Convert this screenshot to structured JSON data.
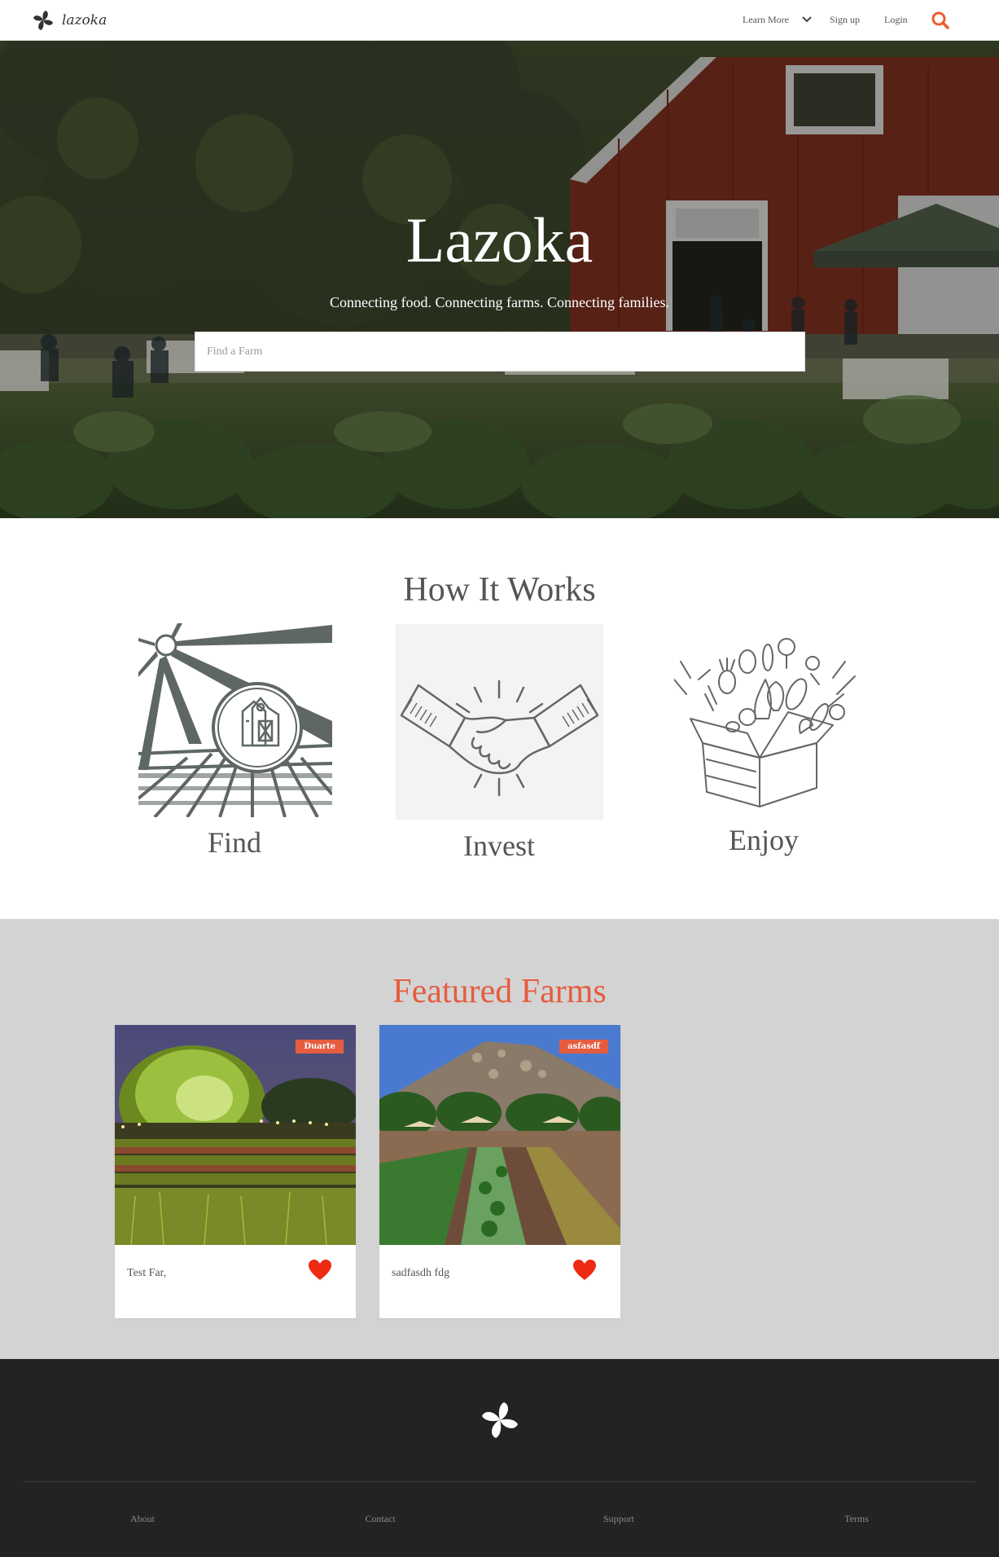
{
  "nav": {
    "brand": "lazoka",
    "learn_more": "Learn More",
    "sign_up": "Sign up",
    "login": "Login",
    "accent_color": "#f05a28"
  },
  "hero": {
    "title": "Lazoka",
    "subtitle": "Connecting food. Connecting farms. Connecting families.",
    "search_placeholder": "Find a Farm",
    "search_value": ""
  },
  "how_it_works": {
    "title": "How It Works",
    "steps": [
      {
        "label": "Find",
        "icon": "farm-magnifier-illustration"
      },
      {
        "label": "Invest",
        "icon": "handshake-illustration"
      },
      {
        "label": "Enjoy",
        "icon": "vegetable-box-illustration"
      }
    ]
  },
  "featured": {
    "title": "Featured Farms",
    "title_color": "#e65c3f",
    "farms": [
      {
        "badge": "Duarte",
        "name": "Test Far,",
        "favorited": true
      },
      {
        "badge": "asfasdf",
        "name": "sadfasdh fdg",
        "favorited": true
      }
    ]
  },
  "footer": {
    "links": [
      "About",
      "Contact",
      "Support",
      "Terms"
    ]
  }
}
